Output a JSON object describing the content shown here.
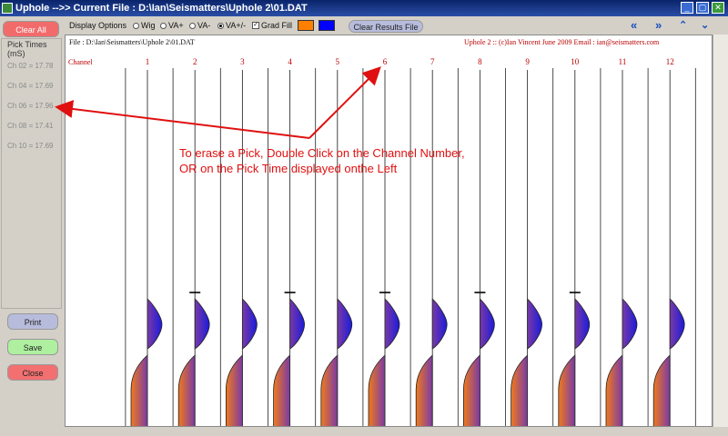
{
  "window": {
    "title": "Uphole -->> Current File : D:\\Ian\\Seismatters\\Uphole 2\\01.DAT"
  },
  "left_panel": {
    "clear_all_label": "Clear All",
    "pick_times_title": "Pick Times (mS)",
    "picks": [
      "Ch 02 = 17.78",
      "Ch 04 = 17.69",
      "Ch 06 = 17.96",
      "Ch 08 = 17.41",
      "Ch 10 = 17.69"
    ],
    "print_label": "Print",
    "save_label": "Save",
    "close_label": "Close"
  },
  "toolbar": {
    "display_options_label": "Display Options",
    "radio_wig": "Wig",
    "radio_vaplus": "VA+",
    "radio_vaminus": "VA-",
    "radio_vaplusminus": "VA+/-",
    "selected_option": "VA+/-",
    "grad_fill_label": "Grad Fill",
    "grad_fill_checked": true,
    "color1": "#ff8000",
    "color2": "#0000ff",
    "clear_results_label": "Clear Results File"
  },
  "plot": {
    "file_label": "File : D:\\Ian\\Seismatters\\Uphole 2\\01.DAT",
    "copyright": "Uphole 2 :: (c)Ian Vincent June 2009 Email : ian@seismatters.com",
    "channel_label": "Channel",
    "channels": [
      "1",
      "2",
      "3",
      "4",
      "5",
      "6",
      "7",
      "8",
      "9",
      "10",
      "11",
      "12"
    ],
    "picked_channels": [
      2,
      4,
      6,
      8,
      10
    ]
  },
  "annotation": {
    "line1": "To erase a Pick, Double Click on the Channel Number,",
    "line2": "OR on the Pick Time displayed onthe Left",
    "color": "#e01010"
  }
}
